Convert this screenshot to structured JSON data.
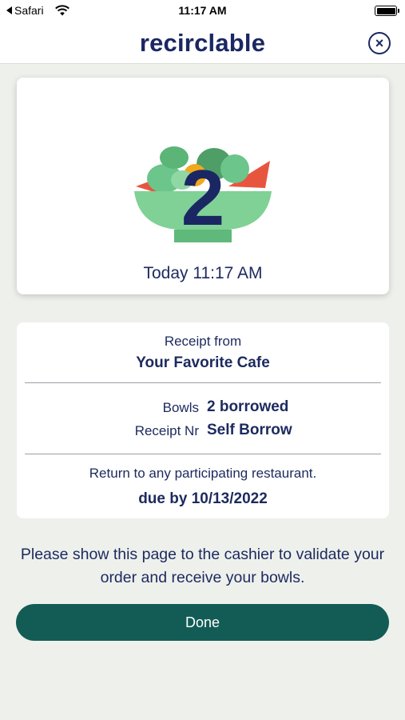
{
  "status_bar": {
    "back_app": "Safari",
    "time": "11:17 AM"
  },
  "header": {
    "logo": "recirclable",
    "close_icon": "close-icon"
  },
  "order": {
    "bowl_count": "2",
    "timestamp": "Today 11:17 AM",
    "illustration": "salad-bowl-icon"
  },
  "receipt": {
    "from_label": "Receipt from",
    "cafe_name": "Your Favorite Cafe",
    "bowls_label": "Bowls",
    "bowls_value": "2 borrowed",
    "receipt_nr_label": "Receipt Nr",
    "receipt_nr_value": "Self Borrow",
    "return_text": "Return to any participating restaurant.",
    "due_text": "due by 10/13/2022"
  },
  "instructions": "Please show this page to the cashier to validate your order and receive your bowls.",
  "done_label": "Done",
  "colors": {
    "navy": "#1b2763",
    "done_button": "#135c56",
    "bowl_green": "#7fd196",
    "tomato": "#e8553e"
  }
}
